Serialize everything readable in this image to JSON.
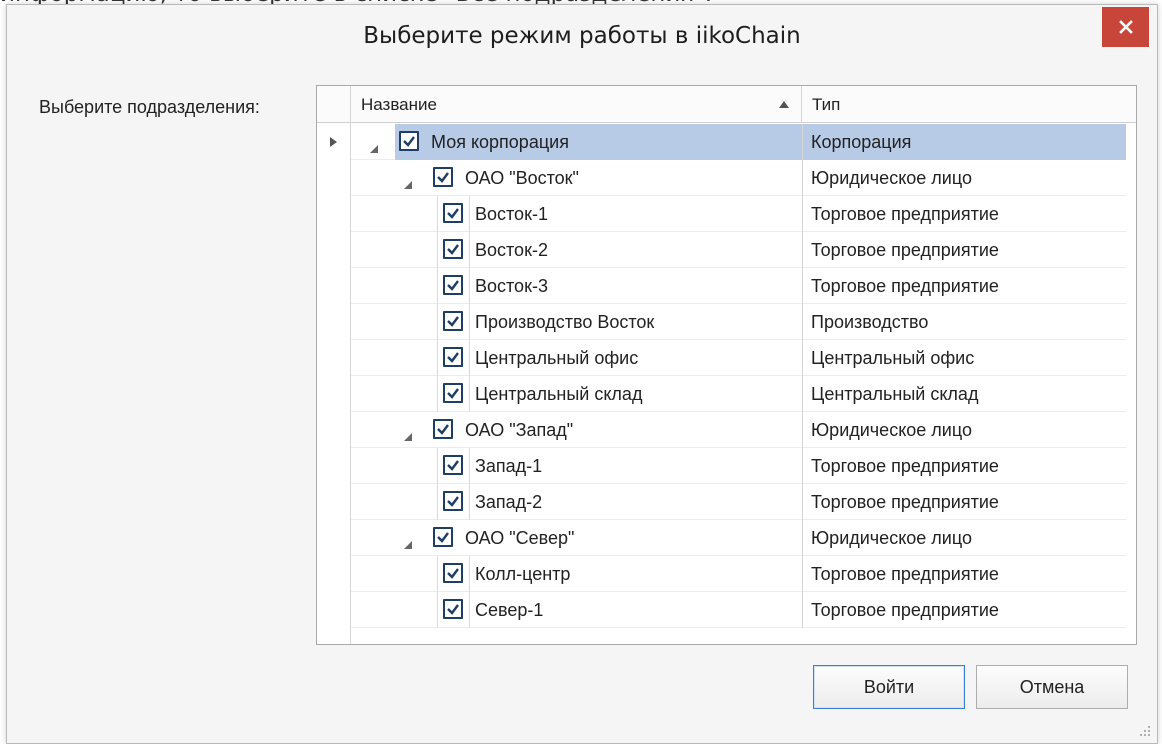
{
  "page_text_top": "информацию, то выберите в списке \"Все подразделения\".",
  "dialog": {
    "title": "Выберите режим работы в iikoChain",
    "close_icon": "close-icon"
  },
  "label": "Выберите подразделения:",
  "grid": {
    "columns": {
      "name": "Название",
      "type": "Тип"
    },
    "sort_direction": "ascending",
    "rows": [
      {
        "name": "Моя корпорация",
        "type": "Корпорация",
        "level": 0,
        "checked": true,
        "expanded": true,
        "selected": true
      },
      {
        "name": "ОАО \"Восток\"",
        "type": "Юридическое лицо",
        "level": 1,
        "checked": true,
        "expanded": true
      },
      {
        "name": "Восток-1",
        "type": "Торговое предприятие",
        "level": 2,
        "checked": true
      },
      {
        "name": "Восток-2",
        "type": "Торговое предприятие",
        "level": 2,
        "checked": true
      },
      {
        "name": "Восток-3",
        "type": "Торговое предприятие",
        "level": 2,
        "checked": true
      },
      {
        "name": "Производство Восток",
        "type": "Производство",
        "level": 2,
        "checked": true
      },
      {
        "name": "Центральный офис",
        "type": "Центральный офис",
        "level": 2,
        "checked": true
      },
      {
        "name": "Центральный склад",
        "type": "Центральный склад",
        "level": 2,
        "checked": true
      },
      {
        "name": "ОАО \"Запад\"",
        "type": "Юридическое лицо",
        "level": 1,
        "checked": true,
        "expanded": true
      },
      {
        "name": "Запад-1",
        "type": "Торговое предприятие",
        "level": 2,
        "checked": true
      },
      {
        "name": "Запад-2",
        "type": "Торговое предприятие",
        "level": 2,
        "checked": true
      },
      {
        "name": "ОАО \"Север\"",
        "type": "Юридическое лицо",
        "level": 1,
        "checked": true,
        "expanded": true
      },
      {
        "name": "Колл-центр",
        "type": "Торговое предприятие",
        "level": 2,
        "checked": true
      },
      {
        "name": "Север-1",
        "type": "Торговое предприятие",
        "level": 2,
        "checked": true
      }
    ]
  },
  "buttons": {
    "login": "Войти",
    "cancel": "Отмена"
  },
  "colors": {
    "close_button": "#c8453a",
    "selection": "#b7cbe6",
    "checkbox_border": "#1f3e63",
    "primary_border": "#3c7fd1"
  }
}
